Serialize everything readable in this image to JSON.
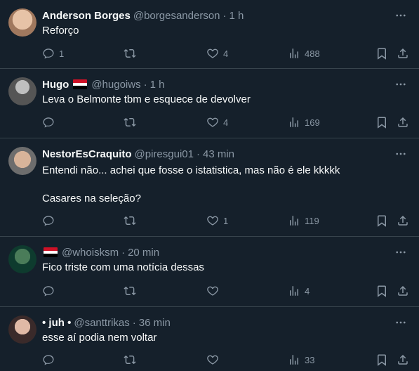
{
  "tweets": [
    {
      "name": "Anderson Borges",
      "handle": "@borgesanderson",
      "time": "1 h",
      "text": "Reforço",
      "replies": "1",
      "retweets": "",
      "likes": "4",
      "views": "488",
      "flag": false
    },
    {
      "name": "Hugo",
      "handle": "@hugoiws",
      "time": "1 h",
      "text": "Leva o Belmonte tbm e esquece de devolver",
      "replies": "",
      "retweets": "",
      "likes": "4",
      "views": "169",
      "flag": true
    },
    {
      "name": "NestorEsCraquito",
      "handle": "@piresgui01",
      "time": "43 min",
      "text": "Entendi não... achei que fosse o istatistica, mas não é ele kkkkk\n\nCasares na seleção?",
      "replies": "",
      "retweets": "",
      "likes": "1",
      "views": "119",
      "flag": false
    },
    {
      "name": "",
      "handle": "@whoisksm",
      "time": "20 min",
      "text": "Fico triste com uma notícia dessas",
      "replies": "",
      "retweets": "",
      "likes": "",
      "views": "4",
      "flag": true
    },
    {
      "name": "• juh •",
      "handle": "@santtrikas",
      "time": "36 min",
      "text": "esse aí podia nem voltar",
      "replies": "",
      "retweets": "",
      "likes": "",
      "views": "33",
      "flag": false
    }
  ],
  "dot": "·",
  "colors": {
    "background": "#15202b",
    "text": "#f7f9f9",
    "muted": "#8b98a5",
    "border": "#38444d"
  }
}
